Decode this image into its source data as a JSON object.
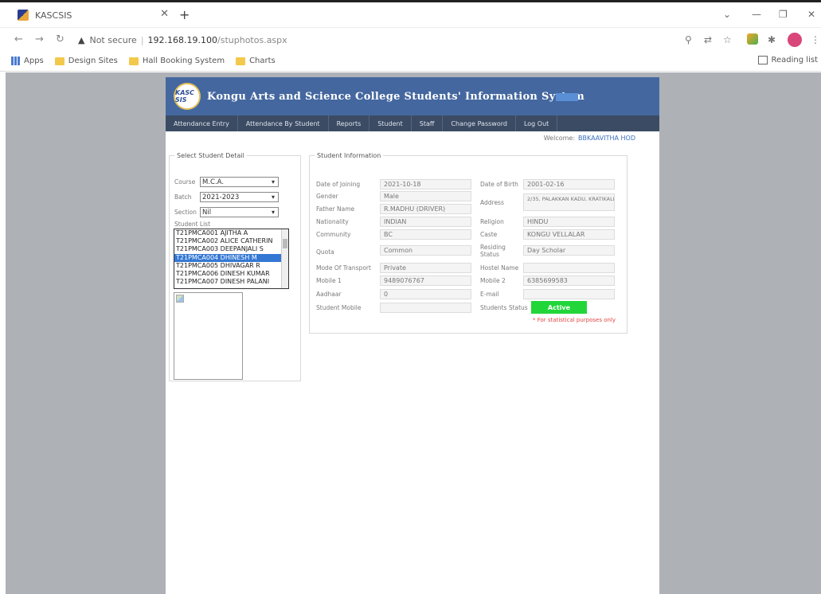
{
  "browser": {
    "tab_title": "KASCSIS",
    "security_label": "Not secure",
    "url_host": "192.168.19.100",
    "url_path": "/stuphotos.aspx",
    "bookmarks": [
      "Apps",
      "Design Sites",
      "Hall Booking System",
      "Charts"
    ],
    "reading_list": "Reading list"
  },
  "site": {
    "logo_text": "KASC SIS",
    "title": "Kongu Arts and Science College Students' Information System",
    "menu": [
      "Attendance Entry",
      "Attendance By Student",
      "Reports",
      "Student",
      "Staff",
      "Change Password",
      "Log Out"
    ],
    "welcome_label": "Welcome:",
    "welcome_user": "BBKAAVITHA HOD"
  },
  "select_student": {
    "legend": "Select Student Detail",
    "course_label": "Course",
    "course_value": "M.C.A.",
    "batch_label": "Batch",
    "batch_value": "2021-2023",
    "section_label": "Section",
    "section_value": "Nil",
    "list_label": "Student List",
    "students": [
      "T21PMCA001 AJITHA A",
      "T21PMCA002 ALICE CATHERIN",
      "T21PMCA003 DEEPANJALI S",
      "T21PMCA004 DHINESH M",
      "T21PMCA005 DHIVAGAR R",
      "T21PMCA006 DINESH KUMAR",
      "T21PMCA007 DINESH PALANI"
    ],
    "selected_index": 3
  },
  "student_info": {
    "legend": "Student Information",
    "left": [
      {
        "label": "Date of Joining",
        "value": "2021-10-18"
      },
      {
        "label": "Gender",
        "value": "Male"
      },
      {
        "label": "Father Name",
        "value": "R.MADHU (DRIVER)"
      },
      {
        "label": "Nationality",
        "value": "INDIAN"
      },
      {
        "label": "Community",
        "value": "BC"
      },
      {
        "label": "Quota",
        "value": "Common"
      },
      {
        "label": "Mode Of Transport",
        "value": "Private"
      },
      {
        "label": "Mobile 1",
        "value": "9489076767"
      },
      {
        "label": "Aadhaar",
        "value": "0"
      },
      {
        "label": "Student Mobile",
        "value": ""
      }
    ],
    "right": [
      {
        "label": "Date of Birth",
        "value": "2001-02-16"
      },
      {
        "label": "Address",
        "value": "2/35, PALAKKAN KADU, KRATIKALPALAYAM,"
      },
      {
        "label": "Religion",
        "value": "HINDU"
      },
      {
        "label": "Caste",
        "value": "KONGU VELLALAR"
      },
      {
        "label": "Residing Status",
        "value": "Day Scholar"
      },
      {
        "label": "Hostel Name",
        "value": ""
      },
      {
        "label": "Mobile 2",
        "value": "6385699583"
      },
      {
        "label": "E-mail",
        "value": ""
      },
      {
        "label": "Students Status",
        "value": "Active"
      }
    ],
    "note": "* For statistical purposes only"
  },
  "colors": {
    "banner": "#44679f",
    "menubar": "#3b4b63",
    "status_active": "#22d63a",
    "list_selected": "#3478d4",
    "note": "#e24545"
  }
}
